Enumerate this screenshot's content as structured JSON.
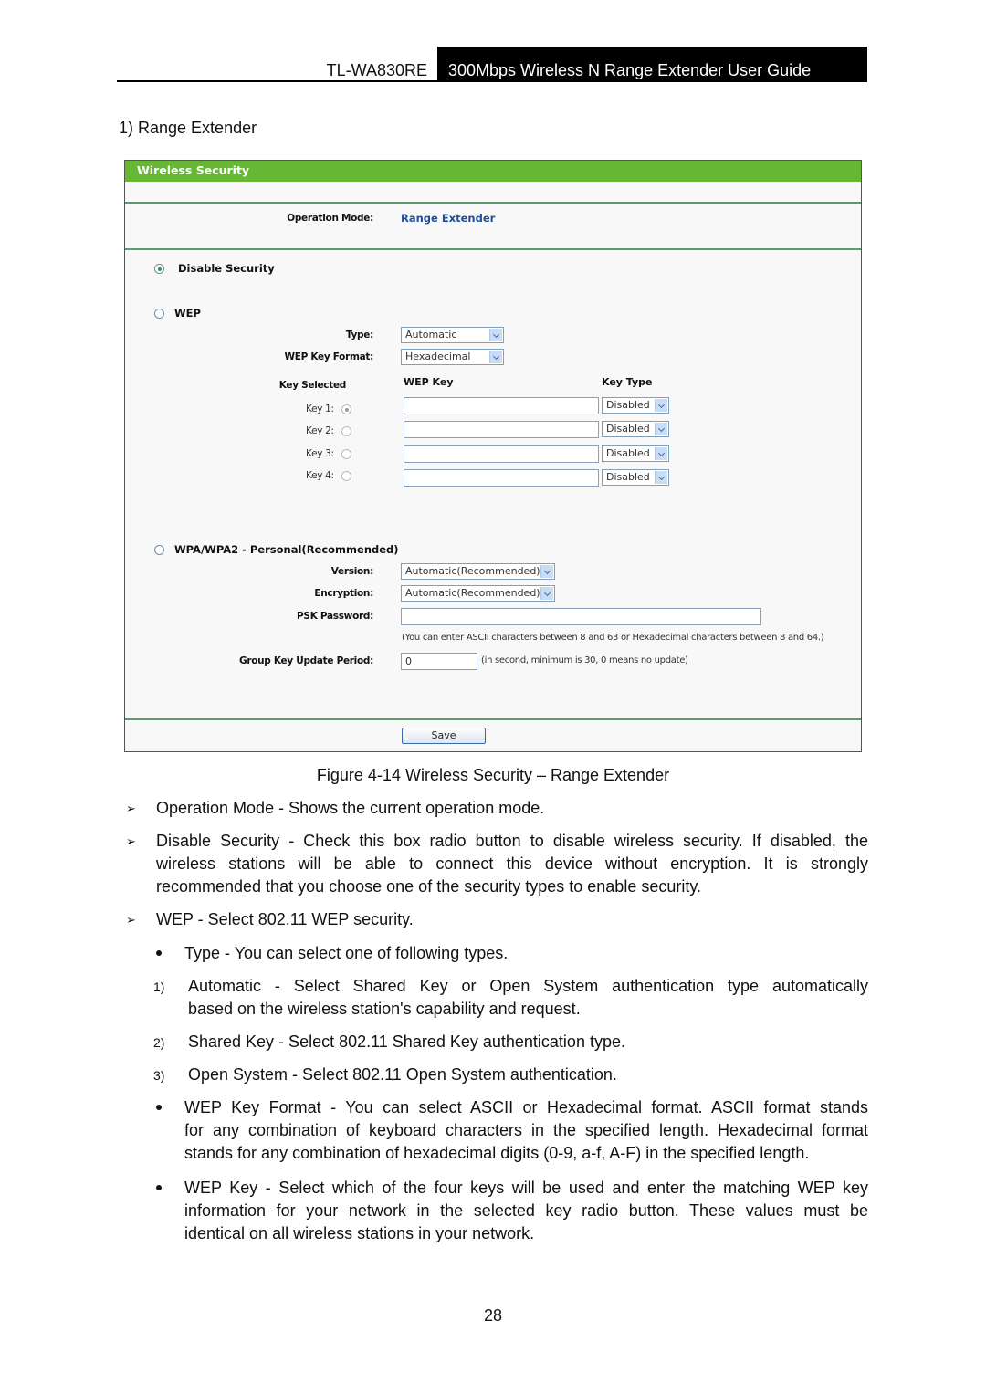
{
  "header": {
    "model": "TL-WA830RE",
    "guide_title": "300Mbps Wireless N Range Extender User Guide"
  },
  "section_title": "1) Range Extender",
  "panel": {
    "title": "Wireless Security",
    "operation_mode_label": "Operation Mode:",
    "operation_mode_value": "Range Extender",
    "disable_security": {
      "label": "Disable Security",
      "selected": true
    },
    "wep": {
      "label": "WEP",
      "selected": false,
      "type_label": "Type:",
      "type_value": "Automatic",
      "format_label": "WEP Key Format:",
      "format_value": "Hexadecimal",
      "col_key_selected": "Key Selected",
      "col_wep_key": "WEP Key",
      "col_key_type": "Key Type",
      "keys": [
        {
          "label": "Key 1:",
          "selected": true,
          "value": "",
          "type": "Disabled"
        },
        {
          "label": "Key 2:",
          "selected": false,
          "value": "",
          "type": "Disabled"
        },
        {
          "label": "Key 3:",
          "selected": false,
          "value": "",
          "type": "Disabled"
        },
        {
          "label": "Key 4:",
          "selected": false,
          "value": "",
          "type": "Disabled"
        }
      ]
    },
    "wpa": {
      "label": "WPA/WPA2 - Personal(Recommended)",
      "selected": false,
      "version_label": "Version:",
      "version_value": "Automatic(Recommended)",
      "encryption_label": "Encryption:",
      "encryption_value": "Automatic(Recommended)",
      "psk_label": "PSK Password:",
      "psk_value": "",
      "psk_hint": "(You can enter ASCII characters between 8 and 63 or Hexadecimal characters between 8 and 64.)",
      "group_key_label": "Group Key Update Period:",
      "group_key_value": "0",
      "group_key_hint": "(in second, minimum is 30, 0 means no update)"
    },
    "save_label": "Save"
  },
  "caption": "Figure 4-14 Wireless Security – Range Extender",
  "body": {
    "operation_mode": "Operation Mode -   Shows the current operation mode.",
    "disable_security_lines": [
      "Disable Security   - Check this box radio button to disable wireless security. If disabled, the",
      "wireless stations will be able to connect this device without encryption. It is strongly",
      "recommended that you choose one of the security types to enable security."
    ],
    "wep": "WEP - Select 802.11 WEP security.",
    "type": "Type - You can select one of following types.",
    "type_items": [
      {
        "num": "1)",
        "lines": [
          "Automatic  - Select Shared Key  or Open System  authentication type automatically",
          "based on the wireless station's capability and request."
        ]
      },
      {
        "num": "2)",
        "lines": [
          "Shared Key  - Select 802.11 Shared Key  authentication type."
        ]
      },
      {
        "num": "3)",
        "lines": [
          "Open System  - Select 802.11 Open System  authentication."
        ]
      }
    ],
    "wep_key_format_lines": [
      "WEP Key Format  - You can select ASCII or Hexadecimal  format. ASCII format stands",
      "for any combination of keyboard characters in the specified length. Hexadecimal format",
      "stands for any combination of hexadecimal digits (0-9, a-f, A-F) in the specified length."
    ],
    "wep_key_lines": [
      "WEP Key - Select which of the four keys will be used and enter the matching WEP key",
      "information for your network in the selected key radio button. These values must be",
      "identical on all wireless stations in your network."
    ]
  },
  "page_number": "28"
}
